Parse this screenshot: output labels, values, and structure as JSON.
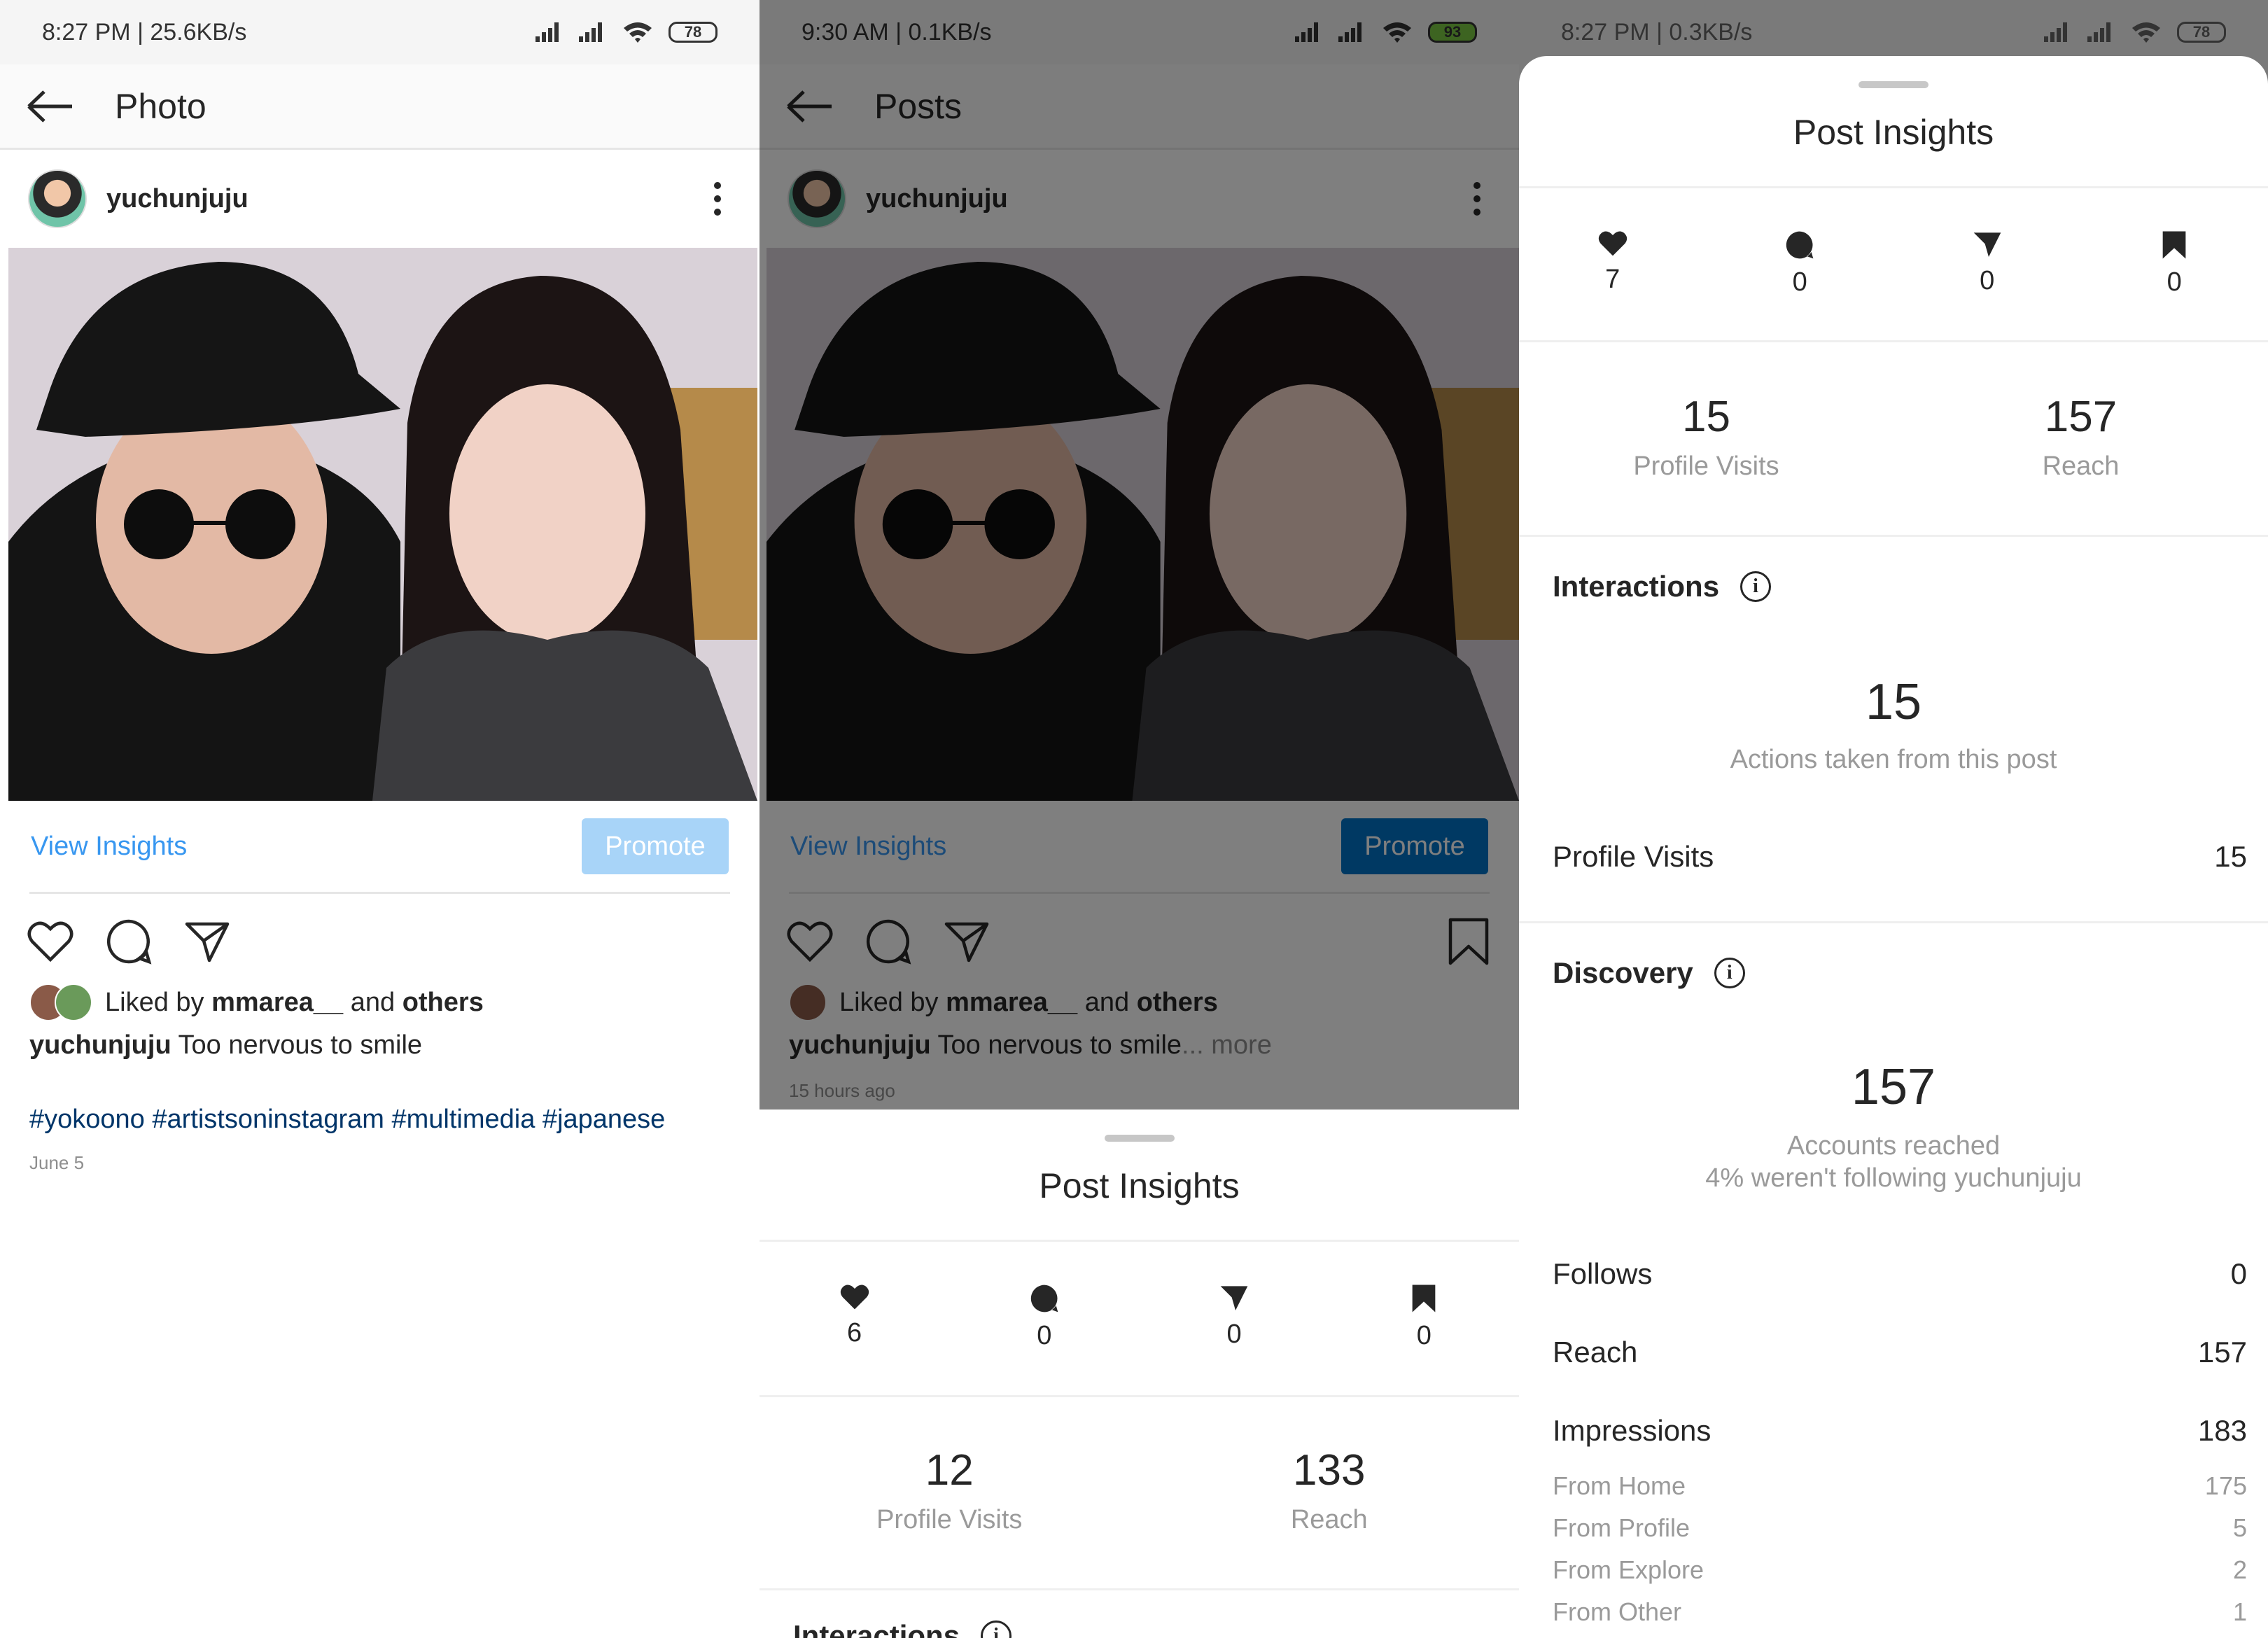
{
  "panel1": {
    "status": {
      "text": "8:27 PM | 25.6KB/s",
      "battery": "78"
    },
    "topbar": {
      "title": "Photo"
    },
    "post": {
      "username": "yuchunjuju",
      "view_insights": "View Insights",
      "promote": "Promote",
      "liked_prefix": "Liked by",
      "liked_user": "mmarea__",
      "liked_and": "and",
      "liked_others": "others",
      "caption_user": "yuchunjuju",
      "caption_text": "Too nervous to smile",
      "hashtags": "#yokoono #artistsoninstagram #multimedia #japanese",
      "date": "June 5"
    }
  },
  "panel2": {
    "status": {
      "text": "9:30 AM | 0.1KB/s",
      "battery": "93"
    },
    "topbar": {
      "title": "Posts"
    },
    "post": {
      "username": "yuchunjuju",
      "view_insights": "View Insights",
      "promote": "Promote",
      "liked_prefix": "Liked by",
      "liked_user": "mmarea__",
      "liked_and": "and",
      "liked_others": "others",
      "caption_user": "yuchunjuju",
      "caption_text": "Too nervous to smile",
      "caption_more": "... more",
      "time_ago": "15 hours ago"
    },
    "sheet": {
      "title": "Post Insights",
      "likes": "6",
      "comments": "0",
      "shares": "0",
      "saves": "0",
      "profile_visits_value": "12",
      "profile_visits_label": "Profile Visits",
      "reach_value": "133",
      "reach_label": "Reach",
      "interactions_label": "Interactions"
    }
  },
  "panel3": {
    "status": {
      "text": "8:27 PM | 0.3KB/s",
      "battery": "78"
    },
    "sheet": {
      "title": "Post Insights",
      "likes": "7",
      "comments": "0",
      "shares": "0",
      "saves": "0",
      "profile_visits_value": "15",
      "profile_visits_label": "Profile Visits",
      "reach_value": "157",
      "reach_label": "Reach",
      "interactions": {
        "heading": "Interactions",
        "actions_value": "15",
        "actions_label": "Actions taken from this post",
        "profile_visits_label": "Profile Visits",
        "profile_visits_value": "15"
      },
      "discovery": {
        "heading": "Discovery",
        "accounts_value": "157",
        "accounts_label": "Accounts reached",
        "not_following": "4% weren't following yuchunjuju",
        "follows_label": "Follows",
        "follows_value": "0",
        "reach_label": "Reach",
        "reach_value": "157",
        "impressions_label": "Impressions",
        "impressions_value": "183",
        "from_home_label": "From Home",
        "from_home_value": "175",
        "from_profile_label": "From Profile",
        "from_profile_value": "5",
        "from_explore_label": "From Explore",
        "from_explore_value": "2",
        "from_other_label": "From Other",
        "from_other_value": "1"
      }
    }
  },
  "colors": {
    "link_blue": "#3897f0",
    "hashtag_blue": "#003569",
    "promote_light": "#a8d4f8",
    "promote_dark": "#0073c7"
  }
}
